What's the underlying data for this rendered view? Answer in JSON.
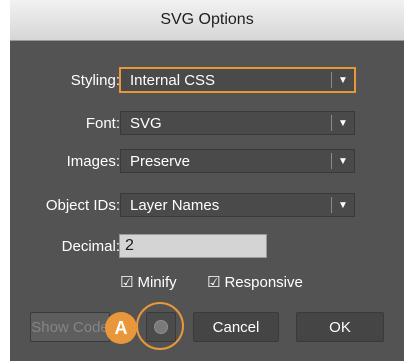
{
  "dialog": {
    "title": "SVG Options"
  },
  "fields": {
    "styling": {
      "label": "Styling:",
      "value": "Internal CSS"
    },
    "font": {
      "label": "Font:",
      "value": "SVG"
    },
    "images": {
      "label": "Images:",
      "value": "Preserve"
    },
    "object_ids": {
      "label": "Object IDs:",
      "value": "Layer Names"
    },
    "decimal": {
      "label": "Decimal:",
      "value": "2"
    }
  },
  "checkboxes": {
    "minify": {
      "label": "Minify",
      "checked": true
    },
    "responsive": {
      "label": "Responsive",
      "checked": true
    }
  },
  "buttons": {
    "show_code": "Show Code",
    "cancel": "Cancel",
    "ok": "OK"
  },
  "callout": {
    "label": "A"
  },
  "icons": {
    "dropdown": "dropdown-arrow-icon",
    "globe": "globe-icon",
    "check": "checkmark-icon"
  },
  "colors": {
    "accent": "#e8973a",
    "panel": "#535353"
  }
}
